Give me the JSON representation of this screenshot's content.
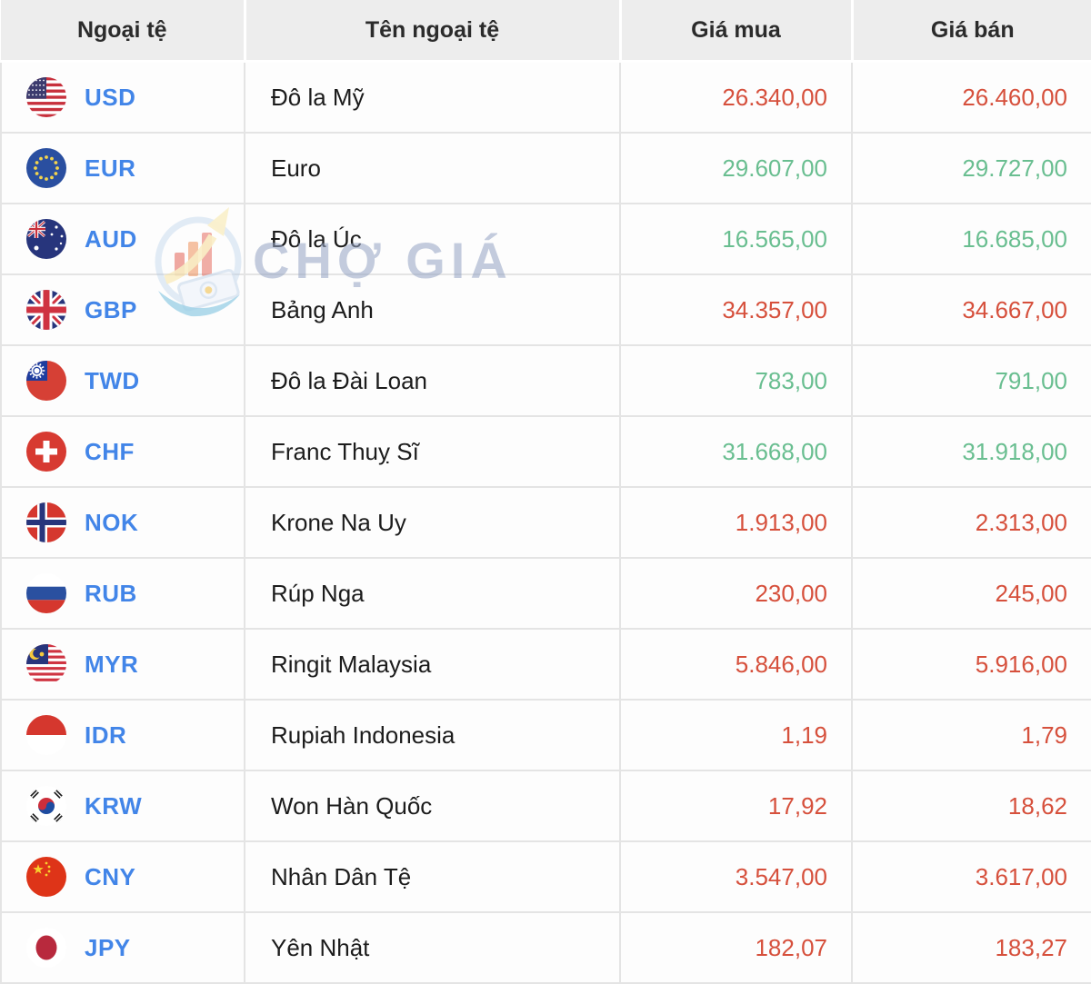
{
  "table": {
    "columns": [
      {
        "label": "Ngoại tệ"
      },
      {
        "label": "Tên ngoại tệ"
      },
      {
        "label": "Giá mua"
      },
      {
        "label": "Giá bán"
      }
    ],
    "rows": [
      {
        "code": "USD",
        "flag_icon": "us-flag-icon",
        "name": "Đô la Mỹ",
        "buy": "26.340,00",
        "sell": "26.460,00",
        "value_color": "red"
      },
      {
        "code": "EUR",
        "flag_icon": "eu-flag-icon",
        "name": "Euro",
        "buy": "29.607,00",
        "sell": "29.727,00",
        "value_color": "green"
      },
      {
        "code": "AUD",
        "flag_icon": "au-flag-icon",
        "name": "Đô la Úc",
        "buy": "16.565,00",
        "sell": "16.685,00",
        "value_color": "green"
      },
      {
        "code": "GBP",
        "flag_icon": "gb-flag-icon",
        "name": "Bảng Anh",
        "buy": "34.357,00",
        "sell": "34.667,00",
        "value_color": "red"
      },
      {
        "code": "TWD",
        "flag_icon": "tw-flag-icon",
        "name": "Đô la Đài Loan",
        "buy": "783,00",
        "sell": "791,00",
        "value_color": "green"
      },
      {
        "code": "CHF",
        "flag_icon": "ch-flag-icon",
        "name": "Franc Thuỵ Sĩ",
        "buy": "31.668,00",
        "sell": "31.918,00",
        "value_color": "green"
      },
      {
        "code": "NOK",
        "flag_icon": "no-flag-icon",
        "name": "Krone Na Uy",
        "buy": "1.913,00",
        "sell": "2.313,00",
        "value_color": "red"
      },
      {
        "code": "RUB",
        "flag_icon": "ru-flag-icon",
        "name": "Rúp Nga",
        "buy": "230,00",
        "sell": "245,00",
        "value_color": "red"
      },
      {
        "code": "MYR",
        "flag_icon": "my-flag-icon",
        "name": "Ringit Malaysia",
        "buy": "5.846,00",
        "sell": "5.916,00",
        "value_color": "red"
      },
      {
        "code": "IDR",
        "flag_icon": "id-flag-icon",
        "name": "Rupiah Indonesia",
        "buy": "1,19",
        "sell": "1,79",
        "value_color": "red"
      },
      {
        "code": "KRW",
        "flag_icon": "kr-flag-icon",
        "name": "Won Hàn Quốc",
        "buy": "17,92",
        "sell": "18,62",
        "value_color": "red"
      },
      {
        "code": "CNY",
        "flag_icon": "cn-flag-icon",
        "name": "Nhân Dân Tệ",
        "buy": "3.547,00",
        "sell": "3.617,00",
        "value_color": "red"
      },
      {
        "code": "JPY",
        "flag_icon": "jp-flag-icon",
        "name": "Yên Nhật",
        "buy": "182,07",
        "sell": "183,27",
        "value_color": "red"
      }
    ]
  },
  "watermark": {
    "text": "CHỢ GIÁ"
  },
  "colors": {
    "red": "#d6503c",
    "green": "#69be90",
    "code_blue": "#4285e8",
    "header_bg": "#ededed"
  }
}
